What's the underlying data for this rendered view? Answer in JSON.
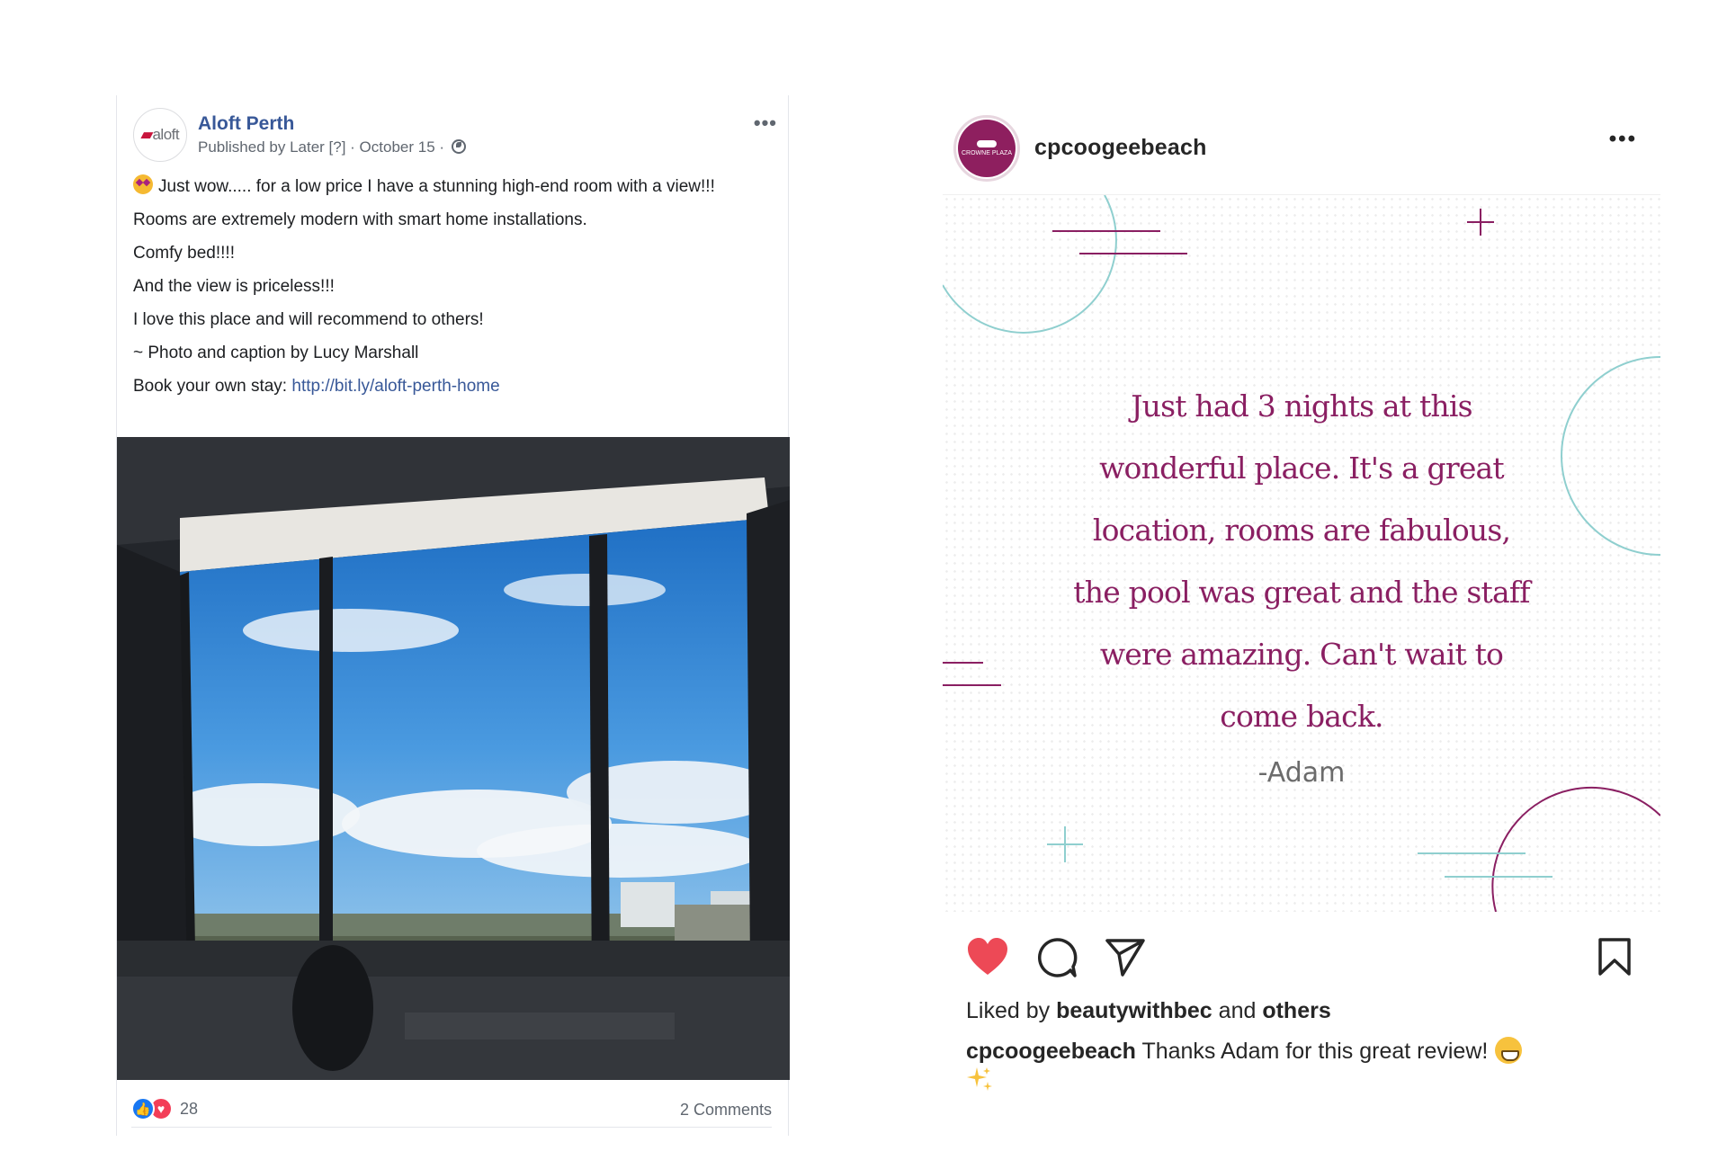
{
  "facebook_post": {
    "page_name": "Aloft Perth",
    "avatar_logo_text": "aloft",
    "meta": "Published by Later [?] · October 15 ·",
    "more_label": "•••",
    "text_lines": [
      "Just wow..... for a low price I have a stunning high-end room with a view!!!",
      "Rooms are extremely modern with smart home installations.",
      "Comfy bed!!!!",
      "And the view is priceless!!!",
      "I love this place and will recommend to others!",
      "~ Photo and caption by Lucy Marshall"
    ],
    "book_label": "Book your own stay: ",
    "book_link": "http://bit.ly/aloft-perth-home",
    "reaction_count": "28",
    "comments": "2 Comments",
    "colors": {
      "link": "#385898",
      "like": "#1877f2",
      "love": "#f33e58"
    }
  },
  "instagram_post": {
    "username": "cpcoogeebeach",
    "avatar_text": "CROWNE PLAZA",
    "more_label": "•••",
    "review_text": "Just had 3 nights at this wonderful place. It's a great location, rooms are fabulous, the pool was great and the staff were amazing. Can't wait to come back.",
    "review_author": "-Adam",
    "liked_by_prefix": "Liked by ",
    "liked_by_user": "beautywithbec",
    "liked_by_middle": " and ",
    "liked_by_others": "others",
    "caption_user": "cpcoogeebeach",
    "caption_text": " Thanks Adam for this great review!",
    "icons": [
      "heart-icon",
      "comment-icon",
      "share-icon",
      "bookmark-icon"
    ],
    "colors": {
      "brand": "#8a1f62",
      "heart": "#ed4956",
      "teal": "#8fcfcf"
    }
  }
}
